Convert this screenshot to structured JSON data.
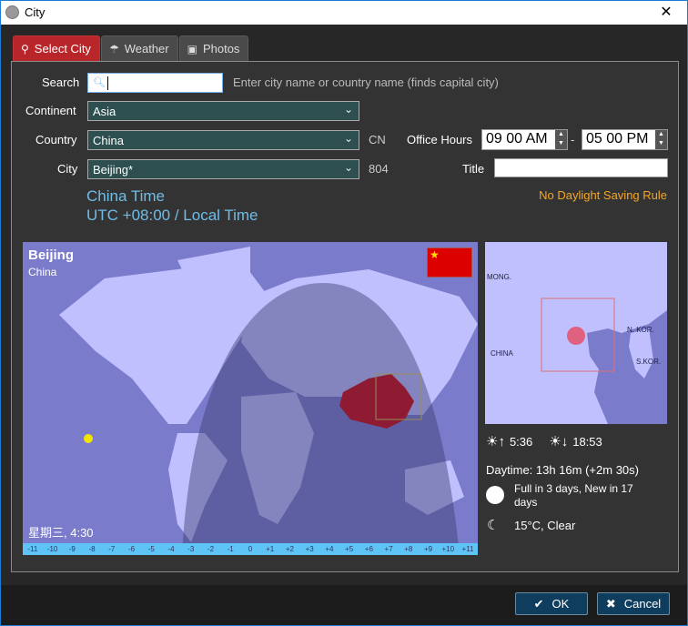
{
  "window": {
    "title": "City",
    "close_icon": "✕"
  },
  "tabs": [
    {
      "label": "Select City",
      "icon": "pin-icon",
      "active": true
    },
    {
      "label": "Weather",
      "icon": "umbrella-icon",
      "active": false
    },
    {
      "label": "Photos",
      "icon": "camera-icon",
      "active": false
    }
  ],
  "form": {
    "search_label": "Search",
    "search_value": "",
    "search_hint": "Enter city name or country name (finds capital city)",
    "continent_label": "Continent",
    "continent_value": "Asia",
    "country_label": "Country",
    "country_value": "China",
    "country_code": "CN",
    "city_label": "City",
    "city_value": "Beijing*",
    "city_code": "804",
    "office_hours_label": "Office Hours",
    "office_start": "09 00 AM",
    "office_separator": "-",
    "office_end": "05 00 PM",
    "title_label": "Title",
    "title_value": "",
    "dst_note": "No Daylight Saving Rule"
  },
  "timezone": {
    "name": "China Time",
    "offset": "UTC +08:00 / Local Time"
  },
  "world_map": {
    "city": "Beijing",
    "country": "China",
    "local_time": "星期三, 4:30",
    "timezone_ticks": [
      "-11",
      "-10",
      "-9",
      "-8",
      "-7",
      "-6",
      "-5",
      "-4",
      "-3",
      "-2",
      "-1",
      "0",
      "+1",
      "+2",
      "+3",
      "+4",
      "+5",
      "+6",
      "+7",
      "+8",
      "+9",
      "+10",
      "+11"
    ],
    "colors": {
      "ocean": "#7b7bcc",
      "land": "#c0c0ff",
      "highlight": "#d40000",
      "tzbar": "#5ec4f5"
    }
  },
  "mini_map": {
    "labels": [
      "MONG.",
      "CHINA",
      "N. KOR.",
      "S.KOR."
    ]
  },
  "sun": {
    "sunrise": "5:36",
    "sunset": "18:53"
  },
  "daytime": "Daytime: 13h 16m (+2m 30s)",
  "moon": "Full in 3 days, New in 17 days",
  "weather": "15°C, Clear",
  "buttons": {
    "ok": "OK",
    "cancel": "Cancel"
  }
}
